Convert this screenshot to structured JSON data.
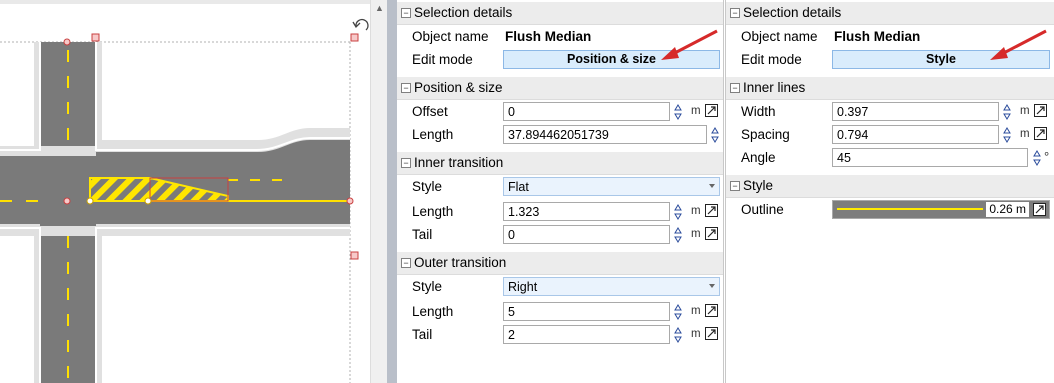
{
  "colors": {
    "road": "#777777",
    "road_edge": "#cfcfcf",
    "marking_yellow": "#ffeb00",
    "selection_red": "#d04a4a",
    "panel_header_bg": "#ececec",
    "button_bg": "#d9ecfc",
    "select_bg": "#eaf3fd",
    "annotation_red": "#d62a2a"
  },
  "canvas": {
    "icons": [
      "rotate-handle-icon",
      "scroll-up-arrow-icon"
    ]
  },
  "left_panel": {
    "selection_details": {
      "title": "Selection details",
      "object_name_label": "Object name",
      "object_name_value": "Flush Median",
      "edit_mode_label": "Edit mode",
      "edit_mode_value": "Position & size"
    },
    "position_size": {
      "title": "Position & size",
      "offset_label": "Offset",
      "offset_value": "0",
      "offset_unit": "m",
      "length_label": "Length",
      "length_value": "37.894462051739"
    },
    "inner_transition": {
      "title": "Inner transition",
      "style_label": "Style",
      "style_value": "Flat",
      "length_label": "Length",
      "length_value": "1.323",
      "length_unit": "m",
      "tail_label": "Tail",
      "tail_value": "0",
      "tail_unit": "m"
    },
    "outer_transition": {
      "title": "Outer transition",
      "style_label": "Style",
      "style_value": "Right",
      "length_label": "Length",
      "length_value": "5",
      "length_unit": "m",
      "tail_label": "Tail",
      "tail_value": "2",
      "tail_unit": "m"
    }
  },
  "right_panel": {
    "selection_details": {
      "title": "Selection details",
      "object_name_label": "Object name",
      "object_name_value": "Flush Median",
      "edit_mode_label": "Edit mode",
      "edit_mode_value": "Style"
    },
    "inner_lines": {
      "title": "Inner lines",
      "width_label": "Width",
      "width_value": "0.397",
      "width_unit": "m",
      "spacing_label": "Spacing",
      "spacing_value": "0.794",
      "spacing_unit": "m",
      "angle_label": "Angle",
      "angle_value": "45",
      "angle_unit": "°"
    },
    "style": {
      "title": "Style",
      "outline_label": "Outline",
      "outline_value": "0.26 m"
    }
  }
}
